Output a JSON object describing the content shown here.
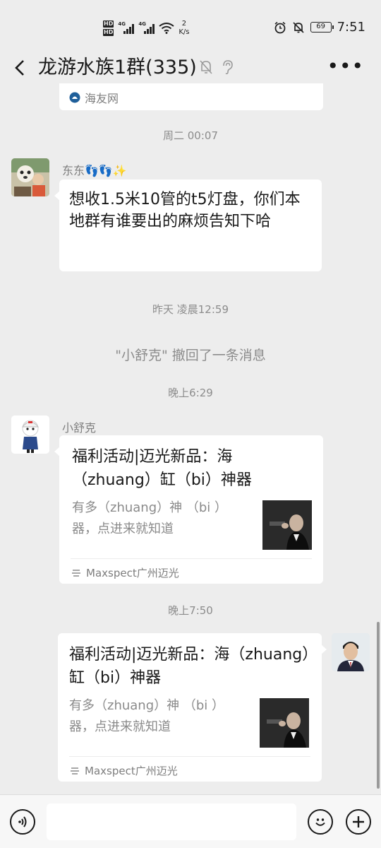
{
  "status_bar": {
    "hd1": "HD",
    "hd2": "HD",
    "net1": "4G",
    "net2": "4G",
    "speed_value": "2",
    "speed_unit": "K/s",
    "battery": "69",
    "time": "7:51"
  },
  "header": {
    "title": "龙游水族1群(335)"
  },
  "messages": {
    "prev_card_source": "海友网",
    "ts1": "周二 00:07",
    "msg1": {
      "sender": "东东👣👣✨",
      "text": "想收1.5米10管的t5灯盘，你们本地群有谁要出的麻烦告知下哈"
    },
    "ts2": "昨天 凌晨12:59",
    "recall": "\"小舒克\" 撤回了一条消息",
    "ts3": "晚上6:29",
    "msg2": {
      "sender": "小舒克",
      "card_title": "福利活动|迈光新品：海（zhuang）缸（bi）神器",
      "card_desc": "有多（zhuang）神 （bi ）器，点进来就知道",
      "card_source": "Maxspect广州迈光"
    },
    "ts4": "晚上7:50",
    "msg3": {
      "card_title": "福利活动|迈光新品：海（zhuang）缸（bi）神器",
      "card_desc": "有多（zhuang）神 （bi ）器，点进来就知道",
      "card_source": "Maxspect广州迈光"
    }
  },
  "input": {
    "placeholder": ""
  },
  "colors": {
    "background": "#ededed",
    "bubble": "#ffffff",
    "timestamp": "#8c8c8c"
  }
}
